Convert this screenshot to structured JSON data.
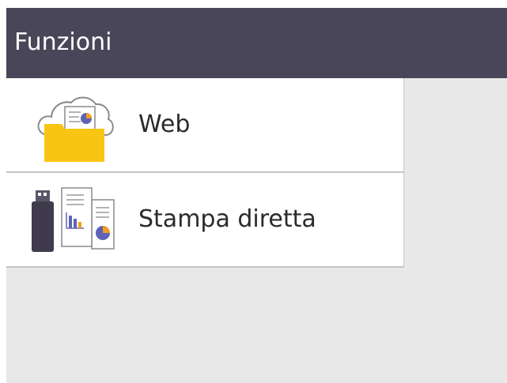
{
  "header": {
    "title": "Funzioni",
    "background": "#4a4659"
  },
  "menu": {
    "items": [
      {
        "label": "Web",
        "icon": "web-cloud-folder-icon"
      },
      {
        "label": "Stampa diretta",
        "icon": "usb-direct-print-icon"
      }
    ]
  },
  "colors": {
    "folder": "#f9c515",
    "usb": "#3f3b4d",
    "chart_blue": "#5e63b5",
    "chart_orange": "#f0a020"
  }
}
